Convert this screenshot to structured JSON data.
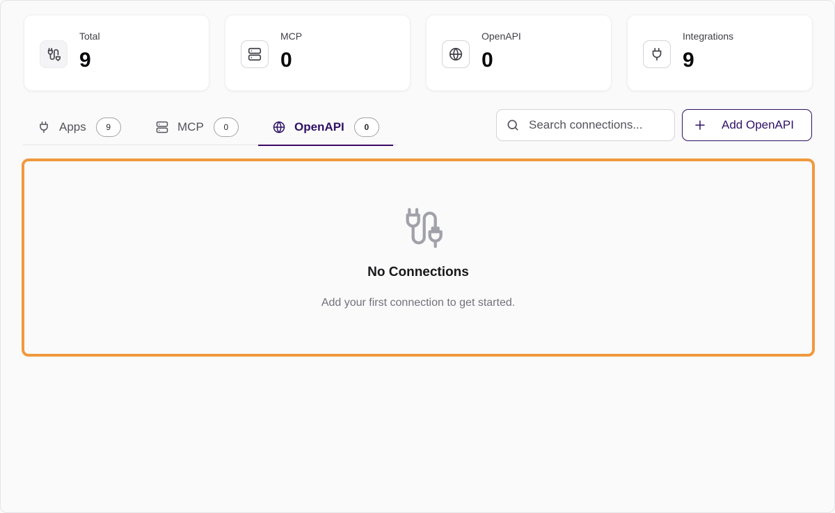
{
  "stats": [
    {
      "label": "Total",
      "value": "9",
      "icon": "plug-cable-icon"
    },
    {
      "label": "MCP",
      "value": "0",
      "icon": "server-icon"
    },
    {
      "label": "OpenAPI",
      "value": "0",
      "icon": "globe-icon"
    },
    {
      "label": "Integrations",
      "value": "9",
      "icon": "plug-icon"
    }
  ],
  "tabs": [
    {
      "label": "Apps",
      "count": "9",
      "icon": "plug-icon",
      "active": false
    },
    {
      "label": "MCP",
      "count": "0",
      "icon": "server-icon",
      "active": false
    },
    {
      "label": "OpenAPI",
      "count": "0",
      "icon": "globe-icon",
      "active": true
    }
  ],
  "search": {
    "placeholder": "Search connections...",
    "value": ""
  },
  "add_button": {
    "label": "Add OpenAPI"
  },
  "empty_state": {
    "icon": "plug-cable-icon",
    "title": "No Connections",
    "subtitle": "Add your first connection to get started."
  },
  "colors": {
    "accent": "#2e1065",
    "highlight_border": "#f0993e",
    "background": "#fafafa"
  }
}
